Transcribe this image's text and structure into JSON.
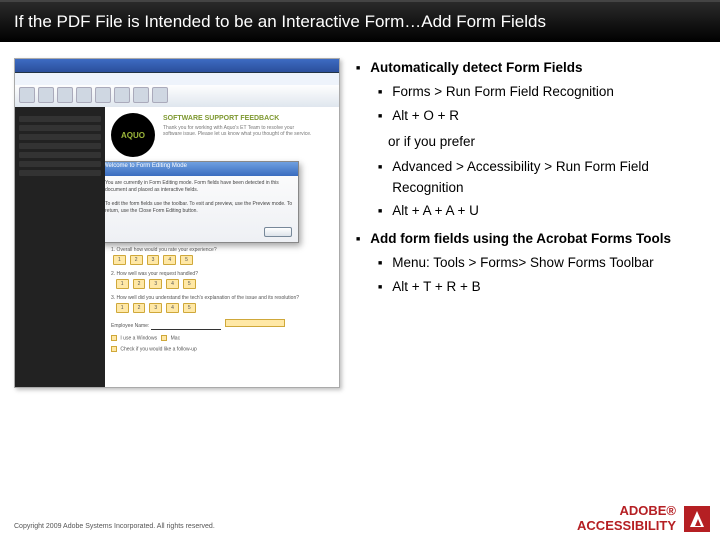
{
  "title": "If the PDF File is Intended to be an Interactive Form…Add Form Fields",
  "bullets": {
    "b1": "Automatically detect Form Fields",
    "b1a": "Forms > Run Form Field Recognition",
    "b1b": "Alt + O + R",
    "orpref": "or if you prefer",
    "b1c": "Advanced > Accessibility > Run Form Field Recognition",
    "b1d": "Alt + A + A + U",
    "b2": "Add form fields using the Acrobat Forms Tools",
    "b2a": "Menu: Tools > Forms> Show Forms Toolbar",
    "b2b": "Alt + T + R + B"
  },
  "thumb": {
    "logo": "AQUO",
    "header": "SOFTWARE SUPPORT FEEDBACK",
    "dialog_title": "Welcome to Form Editing Mode"
  },
  "footer": {
    "copyright": "Copyright 2009 Adobe Systems Incorporated. All rights reserved.",
    "brand1": "ADOBE®",
    "brand2": "ACCESSIBILITY"
  }
}
